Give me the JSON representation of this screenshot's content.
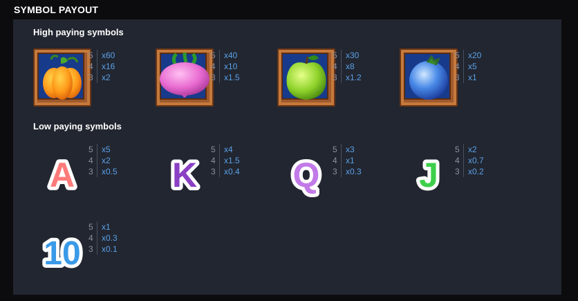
{
  "title": "SYMBOL PAYOUT",
  "high": {
    "heading": "High paying symbols",
    "symbols": [
      {
        "icon": "pumpkin-icon",
        "rows": [
          {
            "count": "5",
            "value": "x60"
          },
          {
            "count": "4",
            "value": "x16"
          },
          {
            "count": "3",
            "value": "x2"
          }
        ]
      },
      {
        "icon": "turnip-icon",
        "rows": [
          {
            "count": "5",
            "value": "x40"
          },
          {
            "count": "4",
            "value": "x10"
          },
          {
            "count": "3",
            "value": "x1.5"
          }
        ]
      },
      {
        "icon": "green-apple-icon",
        "rows": [
          {
            "count": "5",
            "value": "x30"
          },
          {
            "count": "4",
            "value": "x8"
          },
          {
            "count": "3",
            "value": "x1.2"
          }
        ]
      },
      {
        "icon": "blueberry-icon",
        "rows": [
          {
            "count": "5",
            "value": "x20"
          },
          {
            "count": "4",
            "value": "x5"
          },
          {
            "count": "3",
            "value": "x1"
          }
        ]
      }
    ]
  },
  "low": {
    "heading": "Low paying symbols",
    "symbols": [
      {
        "letter": "A",
        "color": "#ff7a7a",
        "rows": [
          {
            "count": "5",
            "value": "x5"
          },
          {
            "count": "4",
            "value": "x2"
          },
          {
            "count": "3",
            "value": "x0.5"
          }
        ]
      },
      {
        "letter": "K",
        "color": "#8a3fc4",
        "rows": [
          {
            "count": "5",
            "value": "x4"
          },
          {
            "count": "4",
            "value": "x1.5"
          },
          {
            "count": "3",
            "value": "x0.4"
          }
        ]
      },
      {
        "letter": "Q",
        "color": "#c27ae8",
        "rows": [
          {
            "count": "5",
            "value": "x3"
          },
          {
            "count": "4",
            "value": "x1"
          },
          {
            "count": "3",
            "value": "x0.3"
          }
        ]
      },
      {
        "letter": "J",
        "color": "#3ecf4a",
        "rows": [
          {
            "count": "5",
            "value": "x2"
          },
          {
            "count": "4",
            "value": "x0.7"
          },
          {
            "count": "3",
            "value": "x0.2"
          }
        ]
      },
      {
        "letter": "10",
        "color": "#3a9ae8",
        "rows": [
          {
            "count": "5",
            "value": "x1"
          },
          {
            "count": "4",
            "value": "x0.3"
          },
          {
            "count": "3",
            "value": "x0.1"
          }
        ]
      }
    ]
  }
}
